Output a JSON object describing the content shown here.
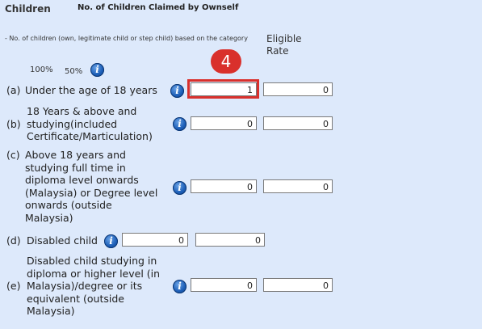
{
  "header": {
    "title": "Children",
    "subtitle": "No. of Children Claimed by Ownself"
  },
  "note": "- No. of children (own, legitimate child or step child) based on the category",
  "column_header": "Eligible Rate",
  "rate_labels": {
    "full": "100%",
    "half": "50%"
  },
  "step_badge": "4",
  "info_glyph": "i",
  "rows": [
    {
      "prefix": "(a)",
      "label": "Under the age of 18 years",
      "value_100": "1",
      "value_50": "0"
    },
    {
      "prefix": "(b)",
      "label_lines": [
        "18 Years & above and",
        "studying(included",
        "Certificate/Marticulation)"
      ],
      "value_100": "0",
      "value_50": "0"
    },
    {
      "prefix": "(c)",
      "label_lines": [
        "Above 18 years and",
        "studying full time in",
        "diploma level onwards",
        "(Malaysia) or Degree level",
        "onwards (outside",
        "Malaysia)"
      ],
      "value_100": "0",
      "value_50": "0"
    },
    {
      "prefix": "(d)",
      "label": "Disabled child",
      "value_100": "0",
      "value_50": "0"
    },
    {
      "prefix": "(e)",
      "label_lines": [
        "Disabled child studying in",
        "diploma or higher level (in",
        "Malaysia)/degree or its",
        "equivalent (outside",
        "Malaysia)"
      ],
      "value_100": "0",
      "value_50": "0"
    }
  ]
}
